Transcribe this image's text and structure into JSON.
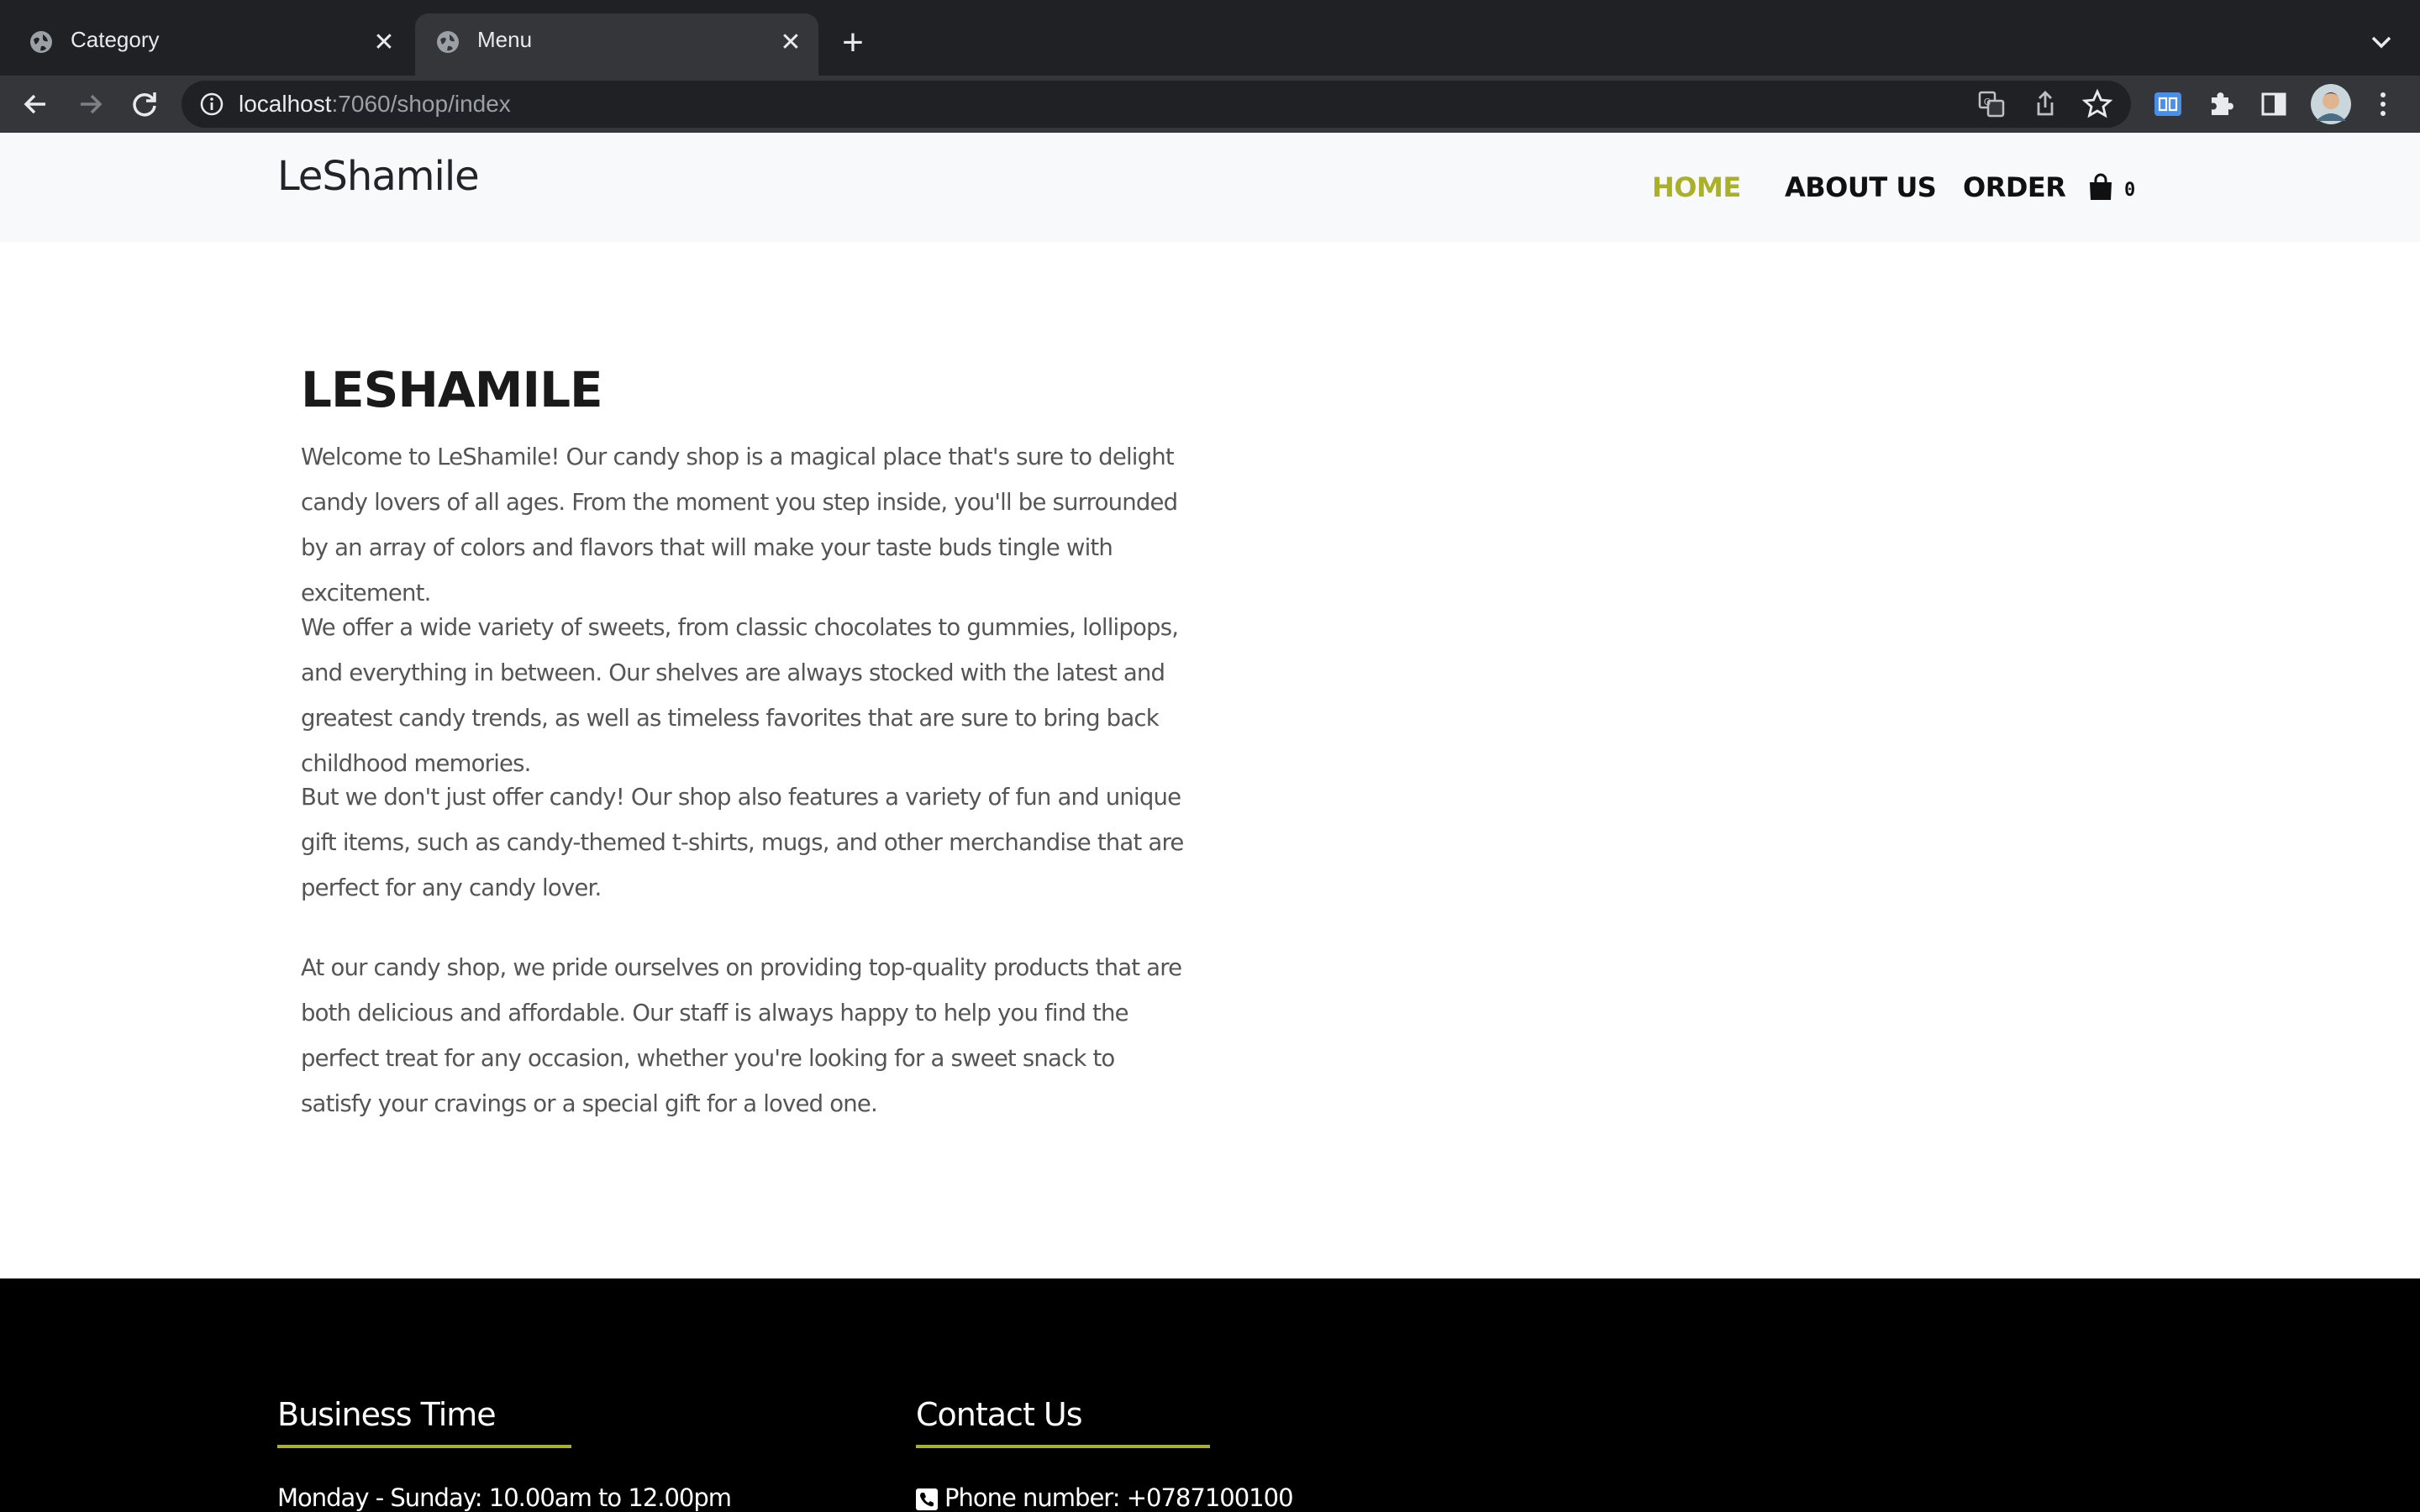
{
  "browser": {
    "tabs": [
      {
        "title": "Category",
        "active": false
      },
      {
        "title": "Menu",
        "active": true
      }
    ],
    "address": {
      "host": "localhost",
      "path": ":7060/shop/index"
    },
    "icons": [
      "back-icon",
      "forward-icon",
      "reload-icon",
      "site-info-icon",
      "translate-icon",
      "share-icon",
      "bookmark-star-icon",
      "reader-extension-icon",
      "extensions-puzzle-icon",
      "side-panel-icon",
      "profile-avatar",
      "more-menu-icon",
      "new-tab-plus-icon",
      "tab-list-chevron-icon"
    ]
  },
  "site": {
    "brand": "LeShamile",
    "nav": {
      "home": "HOME",
      "about": "ABOUT US",
      "order": "ORDER",
      "cart_count": "0"
    },
    "accent_color": "#aab028"
  },
  "main": {
    "title": "LESHAMILE",
    "paragraphs": [
      "Welcome to LeShamile! Our candy shop is a magical place that's sure to delight candy lovers of all ages. From the moment you step inside, you'll be surrounded by an array of colors and flavors that will make your taste buds tingle with excitement.",
      "We offer a wide variety of sweets, from classic chocolates to gummies, lollipops, and everything in between. Our shelves are always stocked with the latest and greatest candy trends, as well as timeless favorites that are sure to bring back childhood memories.",
      "But we don't just offer candy! Our shop also features a variety of fun and unique gift items, such as candy-themed t-shirts, mugs, and other merchandise that are perfect for any candy lover.",
      "At our candy shop, we pride ourselves on providing top-quality products that are both delicious and affordable. Our staff is always happy to help you find the perfect treat for any occasion, whether you're looking for a sweet snack to satisfy your cravings or a special gift for a loved one."
    ]
  },
  "footer": {
    "business": {
      "heading": "Business Time",
      "hours": "Monday - Sunday: 10.00am to 12.00pm"
    },
    "contact": {
      "heading": "Contact Us",
      "phone": "Phone number: +0787100100"
    }
  }
}
